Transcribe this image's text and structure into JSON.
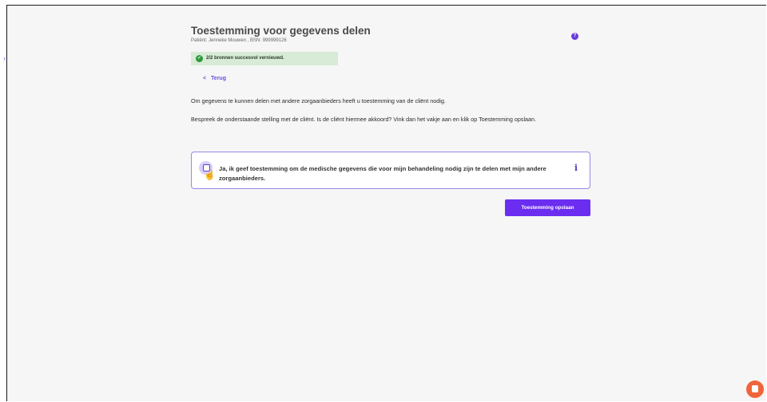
{
  "header": {
    "title": "Toestemming voor gegevens delen",
    "subtitle": "Patiënt: Jenneke Mouwen , BSN: 999999126",
    "help_icon_glyph": "?"
  },
  "banner": {
    "icon_glyph": "✓",
    "text": "2/2 bronnen succesvol vernieuwd."
  },
  "nav": {
    "back_chevron": "<",
    "back_label": "Terug"
  },
  "content": {
    "paragraph_1": "Om gegevens te kunnen delen met andere zorgaanbieders heeft u toestemming van de cliënt nodig.",
    "paragraph_2": "Bespreek de onderstaande stelling met de cliënt. Is de cliënt hiermee akkoord? Vink dan het vakje aan en klik op Toestemming opslaan."
  },
  "consent": {
    "label": "Ja, ik geef toestemming om de medische gegevens die voor mijn behandeling nodig zijn te delen met mijn andere zorgaanbieders.",
    "checked": false,
    "info_glyph": "i"
  },
  "actions": {
    "save_label": "Toestemming opslaan"
  },
  "colors": {
    "accent": "#6b2df0",
    "success_bg": "#d7ebd6",
    "success_icon": "#2f9a3d",
    "chat": "#f0643c"
  },
  "icons": {
    "help": "question-circle-icon",
    "banner": "check-circle-icon",
    "back": "chevron-left-icon",
    "info": "info-icon",
    "chat": "chat-icon",
    "pointer": "hand-pointer-icon"
  }
}
